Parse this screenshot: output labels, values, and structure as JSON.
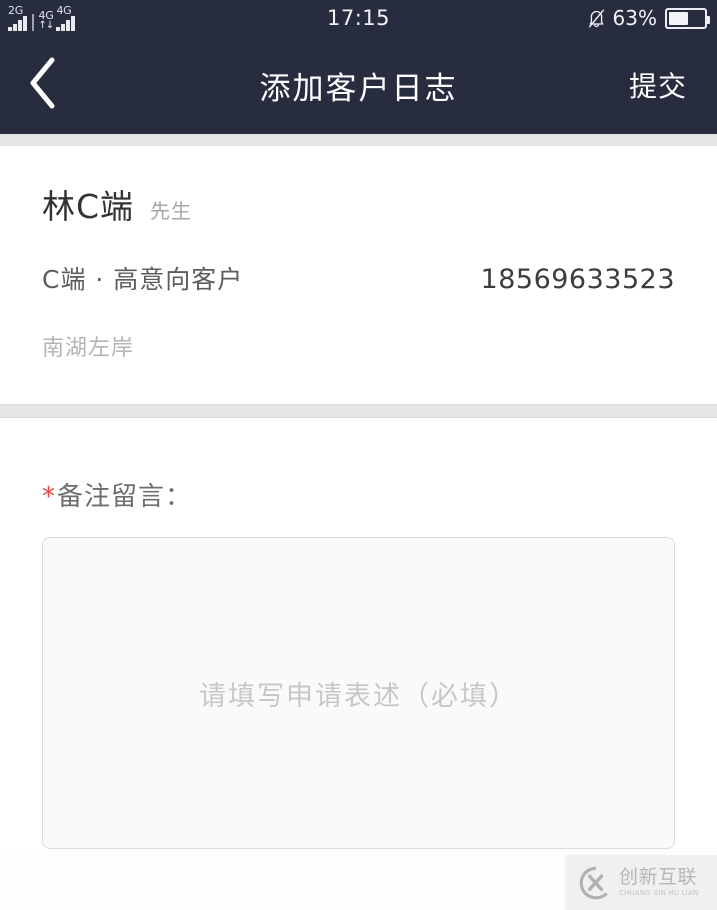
{
  "status_bar": {
    "sim1_network": "2G",
    "sim2_network_a": "4G",
    "sim2_network_b": "4G",
    "data_arrows": "↑↓",
    "time": "17:15",
    "battery_percent": "63%",
    "battery_level": 55,
    "mute_icon": "bell-slash-icon"
  },
  "nav": {
    "back_icon": "chevron-left-icon",
    "title": "添加客户日志",
    "submit_label": "提交"
  },
  "customer": {
    "name": "林C端",
    "honorific": "先生",
    "tags": "C端 · 高意向客户",
    "phone": "18569633523",
    "address": "南湖左岸"
  },
  "form": {
    "required_marker": "*",
    "label": "备注留言：",
    "textarea_value": "",
    "textarea_placeholder": "请填写申请表述（必填）"
  },
  "watermark": {
    "brand_cn": "创新互联",
    "brand_en": "CHUANG XIN HU LIAN"
  },
  "colors": {
    "navbar_bg": "#272c3e",
    "page_bg": "#ffffff",
    "divider": "#e4e5e7",
    "required_red": "#e8403a",
    "placeholder_gray": "#c7c7c7"
  }
}
